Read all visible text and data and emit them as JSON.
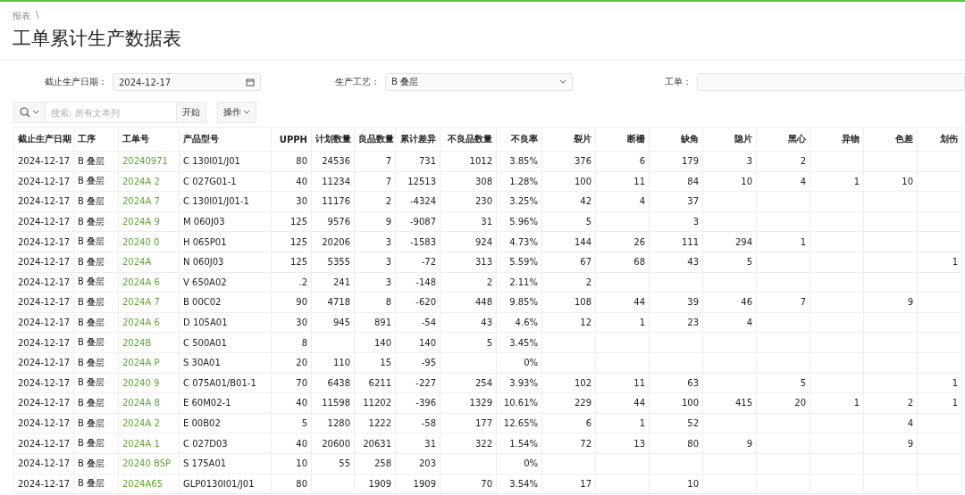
{
  "breadcrumb": [
    "报表",
    "\\"
  ],
  "title": "工单累计生产数据表",
  "filters": [
    {
      "kind": "date",
      "label": "截止生产日期：",
      "value": "2024-12-17"
    },
    {
      "kind": "select",
      "label": "生产工艺：",
      "value": "B 叠层"
    },
    {
      "kind": "text",
      "label": "工单："
    }
  ],
  "toolbar": {
    "search_placeholder": "搜索: 所有文本列",
    "go_button": "开始",
    "actions_button": "操作"
  },
  "table": {
    "columns": [
      "截止生产日期",
      "工序",
      "工单号",
      "产品型号",
      "UPPH",
      "计划数量",
      "良品数量",
      "累计差异",
      "不良品数量",
      "不良率",
      "裂片",
      "断栅",
      "缺角",
      "隐片",
      "黑心",
      "异物",
      "色差",
      "划伤"
    ],
    "rows": [
      {
        "cells": [
          "2024-12-17",
          "B 叠层",
          "20240971",
          "C 130I01/J01",
          "80",
          "24536",
          "7",
          "731",
          "1012",
          "3.85%",
          "376",
          "6",
          "179",
          "3",
          "2",
          null,
          null,
          null
        ]
      },
      {
        "cells": [
          "2024-12-17",
          "B 叠层",
          "2024A 2",
          "C 027G01-1",
          "40",
          "11234",
          "7",
          "12513",
          "308",
          "1.28%",
          "100",
          "11",
          "84",
          "10",
          "4",
          "1",
          "10",
          null
        ]
      },
      {
        "cells": [
          "2024-12-17",
          "B 叠层",
          "2024A 7",
          "C 130I01/J01-1",
          "30",
          "11176",
          "2",
          "-4324",
          "230",
          "3.25%",
          "42",
          "4",
          "37",
          null,
          null,
          null,
          null,
          null
        ]
      },
      {
        "cells": [
          "2024-12-17",
          "B 叠层",
          "2024A 9",
          "M 060J03",
          "125",
          "9576",
          "9",
          "-9087",
          "31",
          "5.96%",
          "5",
          null,
          "3",
          null,
          null,
          null,
          null,
          null
        ]
      },
      {
        "cells": [
          "2024-12-17",
          "B 叠层",
          "20240 0",
          "H 065P01",
          "125",
          "20206",
          "3",
          "-1583",
          "924",
          "4.73%",
          "144",
          "26",
          "111",
          "294",
          "1",
          null,
          null,
          null
        ]
      },
      {
        "cells": [
          "2024-12-17",
          "B 叠层",
          "2024A",
          "N 060J03",
          "125",
          "5355",
          "3",
          "-72",
          "313",
          "5.59%",
          "67",
          "68",
          "43",
          "5",
          null,
          null,
          null,
          "1"
        ]
      },
      {
        "cells": [
          "2024-12-17",
          "B 叠层",
          "2024A 6",
          "V 650A02",
          ".2",
          "241",
          "3",
          "-148",
          "2",
          "2.11%",
          "2",
          null,
          null,
          null,
          null,
          null,
          null,
          null
        ]
      },
      {
        "cells": [
          "2024-12-17",
          "B 叠层",
          "2024A 7",
          "B 00C02",
          "90",
          "4718",
          "8",
          "-620",
          "448",
          "9.85%",
          "108",
          "44",
          "39",
          "46",
          "7",
          null,
          "9",
          null
        ]
      },
      {
        "cells": [
          "2024-12-17",
          "B 叠层",
          "2024A 6",
          "D 105A01",
          "30",
          "945",
          "891",
          "-54",
          "43",
          "4.6%",
          "12",
          "1",
          "23",
          "4",
          null,
          null,
          null,
          null
        ]
      },
      {
        "cells": [
          "2024-12-17",
          "B 叠层",
          "2024B",
          "C 500A01",
          "8",
          null,
          "140",
          "140",
          "5",
          "3.45%",
          null,
          null,
          null,
          null,
          null,
          null,
          null,
          null
        ]
      },
      {
        "cells": [
          "2024-12-17",
          "B 叠层",
          "2024A P",
          "S 30A01",
          "20",
          "110",
          "15",
          "-95",
          null,
          "0%",
          null,
          null,
          null,
          null,
          null,
          null,
          null,
          null
        ]
      },
      {
        "cells": [
          "2024-12-17",
          "B 叠层",
          "20240 9",
          "C 075A01/B01-1",
          "70",
          "6438",
          "6211",
          "-227",
          "254",
          "3.93%",
          "102",
          "11",
          "63",
          null,
          "5",
          null,
          null,
          "1"
        ]
      },
      {
        "cells": [
          "2024-12-17",
          "B 叠层",
          "2024A 8",
          "E 60M02-1",
          "40",
          "11598",
          "11202",
          "-396",
          "1329",
          "10.61%",
          "229",
          "44",
          "100",
          "415",
          "20",
          "1",
          "2",
          "1"
        ]
      },
      {
        "cells": [
          "2024-12-17",
          "B 叠层",
          "2024A 2",
          "E 00B02",
          "5",
          "1280",
          "1222",
          "-58",
          "177",
          "12.65%",
          "6",
          "1",
          "52",
          null,
          null,
          null,
          "4",
          null
        ]
      },
      {
        "cells": [
          "2024-12-17",
          "B 叠层",
          "2024A 1",
          "C 027D03",
          "40",
          "20600",
          "20631",
          "31",
          "322",
          "1.54%",
          "72",
          "13",
          "80",
          "9",
          null,
          null,
          "9",
          null
        ]
      },
      {
        "cells": [
          "2024-12-17",
          "B 叠层",
          "20240 BSP",
          "S 175A01",
          "10",
          "55",
          "258",
          "203",
          null,
          "0%",
          null,
          null,
          null,
          null,
          null,
          null,
          null,
          null
        ]
      },
      {
        "cells": [
          "2024-12-17",
          "B 叠层",
          "2024A65",
          "GLP0130I01/J01",
          "80",
          null,
          "1909",
          "1909",
          "70",
          "3.54%",
          "17",
          null,
          "10",
          null,
          null,
          null,
          null,
          null
        ]
      }
    ]
  }
}
